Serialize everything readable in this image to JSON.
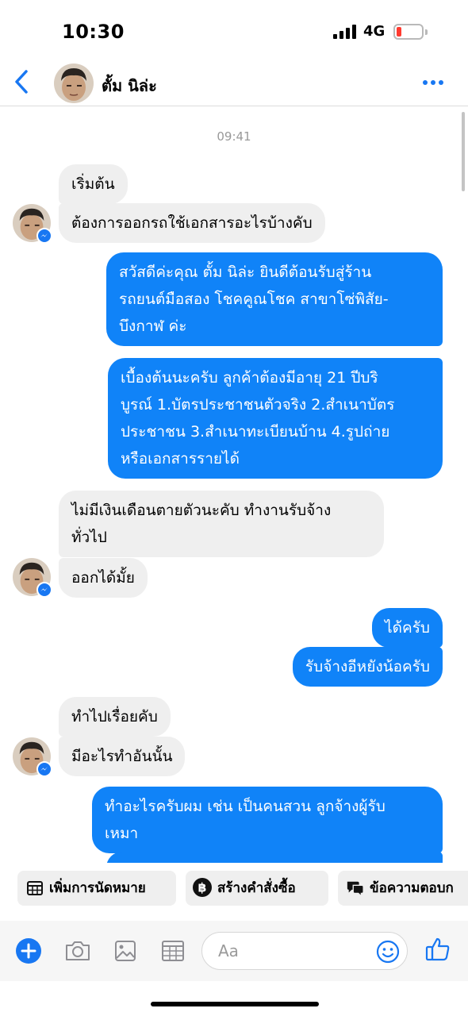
{
  "status": {
    "time": "10:30",
    "network": "4G"
  },
  "header": {
    "contact_name": "ตั้ม นิล่ะ"
  },
  "chat": {
    "timestamp": "09:41",
    "messages": [
      {
        "from": "contact",
        "text": "เริ่มต้น"
      },
      {
        "from": "contact",
        "text": "ต้องการออกรถใช้เอกสารอะไรบ้างคับ"
      },
      {
        "from": "me",
        "line1": "สวัสดีค่ะคุณ ตั้ม นิล่ะ ยินดีต้อนรับสู่ร้าน",
        "line2": "รถยนต์มือสอง โชคคูณโชค สาขาโซ่พิสัย-",
        "line3": "บึงกาฬ ค่ะ"
      },
      {
        "from": "me",
        "line1": "เบื้องต้นนะครับ ลูกค้าต้องมีอายุ 21 ปีบริ",
        "line2": "บูรณ์ 1.บัตรประชาชนตัวจริง 2.สำเนาบัตร",
        "line3": "ประชาชน 3.สำเนาทะเบียนบ้าน 4.รูปถ่าย",
        "line4": "หรือเอกสารรายได้"
      },
      {
        "from": "contact",
        "line1": "ไม่มีเงินเดือนตายตัวนะคับ ทำงานรับจ้าง",
        "line2": "ทั่วไป"
      },
      {
        "from": "contact",
        "text": "ออกได้มั้ย"
      },
      {
        "from": "me",
        "text": "ได้ครับ"
      },
      {
        "from": "me",
        "text": "รับจ้างอีหยังน้อครับ"
      },
      {
        "from": "contact",
        "text": "ทำไปเรื่อยคับ"
      },
      {
        "from": "contact",
        "text": "มีอะไรทำอันนั้น"
      },
      {
        "from": "me",
        "line1": "ทำอะไรครับผม เช่น เป็นคนสวน ลูกจ้างผู้รับ",
        "line2": "เหมา"
      }
    ]
  },
  "quick_actions": {
    "appointment": "เพิ่มการนัดหมาย",
    "create_order": "สร้างคำสั่งซื้อ",
    "saved_reply": "ข้อความตอบก"
  },
  "composer": {
    "placeholder": "Aa"
  },
  "colors": {
    "accent": "#1083f8",
    "incoming_bubble": "#efefef",
    "battery_low": "#ff3b30"
  }
}
